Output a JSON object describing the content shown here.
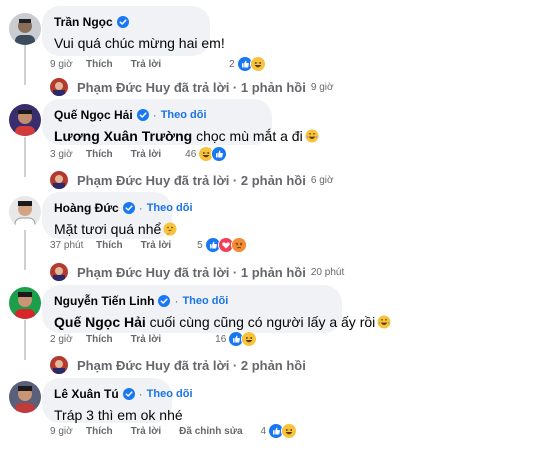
{
  "comments": [
    {
      "name": "Trần Ngọc",
      "follow": "",
      "text_mention": "",
      "text": "Vui quá chúc mừng hai em!",
      "time": "9 giờ",
      "like": "Thích",
      "reply": "Trả lời",
      "edited": "",
      "count": "2",
      "reply_info": {
        "name": "Phạm Đức Huy đã trả lời · 1 phản hồi",
        "time": "9 giờ"
      }
    },
    {
      "name": "Quế Ngọc Hải",
      "follow": "Theo dõi",
      "text_mention": "Lương Xuân Trường",
      "text": " chọc mù mắt a đi",
      "time": "3 giờ",
      "like": "Thích",
      "reply": "Trả lời",
      "edited": "",
      "count": "46",
      "reply_info": {
        "name": "Phạm Đức Huy đã trả lời · 2 phản hồi",
        "time": "6 giờ"
      }
    },
    {
      "name": "Hoàng Đức",
      "follow": "Theo dõi",
      "text_mention": "",
      "text": "Mặt tươi quá nhể",
      "time": "37 phút",
      "like": "Thích",
      "reply": "Trả lời",
      "edited": "",
      "count": "5",
      "reply_info": {
        "name": "Phạm Đức Huy đã trả lời · 1 phản hồi",
        "time": "20 phút"
      }
    },
    {
      "name": "Nguyễn Tiến Linh",
      "follow": "Theo dõi",
      "text_mention": "Quế Ngọc Hải",
      "text": " cuối cùng cũng có người lấy a ấy rồi",
      "time": "2 giờ",
      "like": "Thích",
      "reply": "Trả lời",
      "edited": "",
      "count": "16",
      "reply_info": {
        "name": "Phạm Đức Huy đã trả lời · 2 phản hồi",
        "time": ""
      }
    },
    {
      "name": "Lê Xuân Tú",
      "follow": "Theo dõi",
      "text_mention": "",
      "text": "Tráp 3 thì em ok nhé",
      "time": "9 giờ",
      "like": "Thích",
      "reply": "Trả lời",
      "edited": "Đã chỉnh sửa",
      "count": "4",
      "reply_info": null
    }
  ],
  "separator": "·",
  "colors": {
    "bubble": "#f0f2f5",
    "link": "#1b74e4",
    "meta": "#65676b",
    "like": "#1877f2"
  }
}
